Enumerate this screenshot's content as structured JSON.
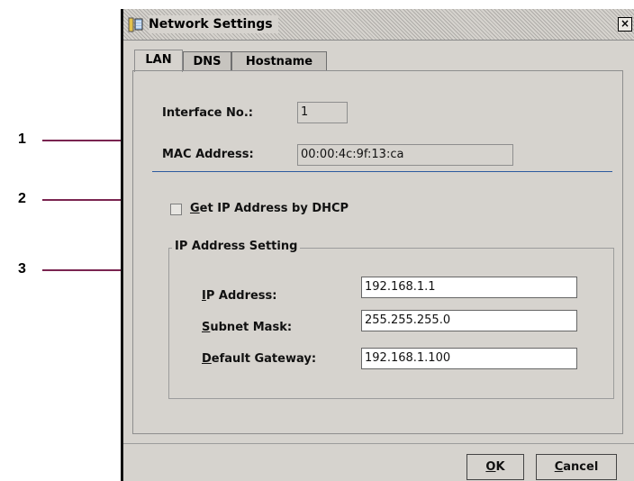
{
  "callouts": [
    "1",
    "2",
    "3"
  ],
  "window": {
    "title": "Network Settings",
    "icon": "network-settings-icon",
    "close_glyph": "×"
  },
  "tabs": [
    {
      "label": "LAN",
      "active": true
    },
    {
      "label": "DNS",
      "active": false
    },
    {
      "label": "Hostname",
      "active": false
    }
  ],
  "lan": {
    "interface_label": "Interface No.:",
    "interface_value": "1",
    "mac_label": "MAC Address:",
    "mac_value": "00:00:4c:9f:13:ca",
    "dhcp_mnemonic": "G",
    "dhcp_rest": "et IP Address by DHCP",
    "dhcp_checked": false,
    "group_title": "IP Address Setting",
    "ip_mnemonic": "I",
    "ip_rest": "P Address:",
    "ip_value": "192.168.1.1",
    "subnet_mnemonic": "S",
    "subnet_rest": "ubnet Mask:",
    "subnet_value": "255.255.255.0",
    "gateway_mnemonic": "D",
    "gateway_rest": "efault Gateway:",
    "gateway_value": "192.168.1.100"
  },
  "buttons": {
    "ok_mnemonic": "O",
    "ok_rest": "K",
    "cancel_mnemonic": "C",
    "cancel_rest": "ancel"
  }
}
